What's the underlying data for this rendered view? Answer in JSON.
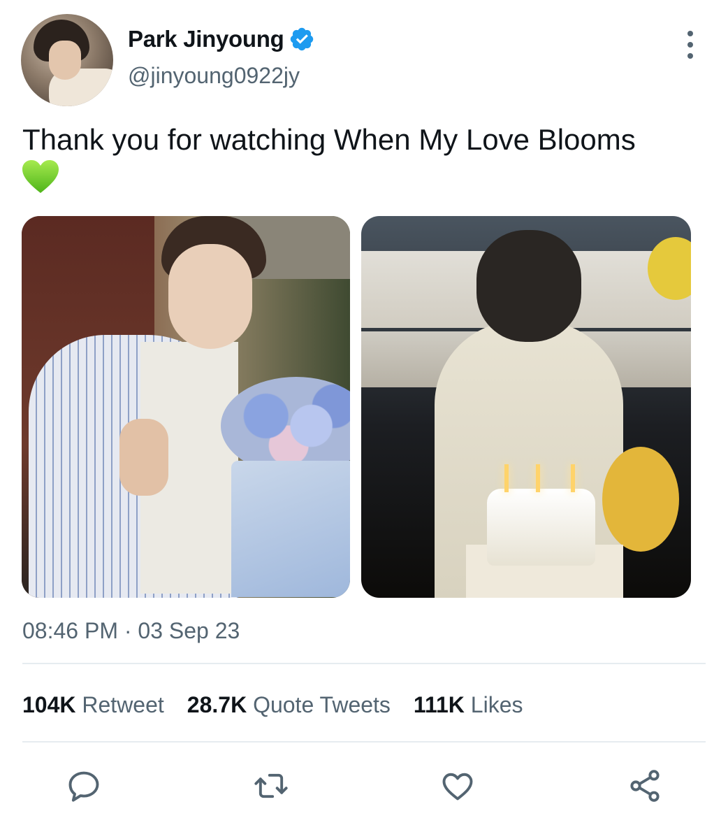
{
  "author": {
    "display_name": "Park Jinyoung",
    "handle": "@jinyoung0922jy",
    "verified": true
  },
  "tweet": {
    "text": "Thank you for watching When My Love Blooms",
    "emoji": "green-heart",
    "timestamp": "08:46 PM · 03 Sep 23"
  },
  "stats": {
    "retweets_count": "104K",
    "retweets_label": "Retweet",
    "quotes_count": "28.7K",
    "quotes_label": "Quote Tweets",
    "likes_count": "111K",
    "likes_label": "Likes"
  },
  "actions": [
    "reply-icon",
    "retweet-icon",
    "like-icon",
    "share-icon"
  ],
  "colors": {
    "verified_blue": "#1d9bf0",
    "secondary_text": "#536471",
    "divider": "#e6ecf0",
    "heart_green": "#6fcf2a"
  }
}
